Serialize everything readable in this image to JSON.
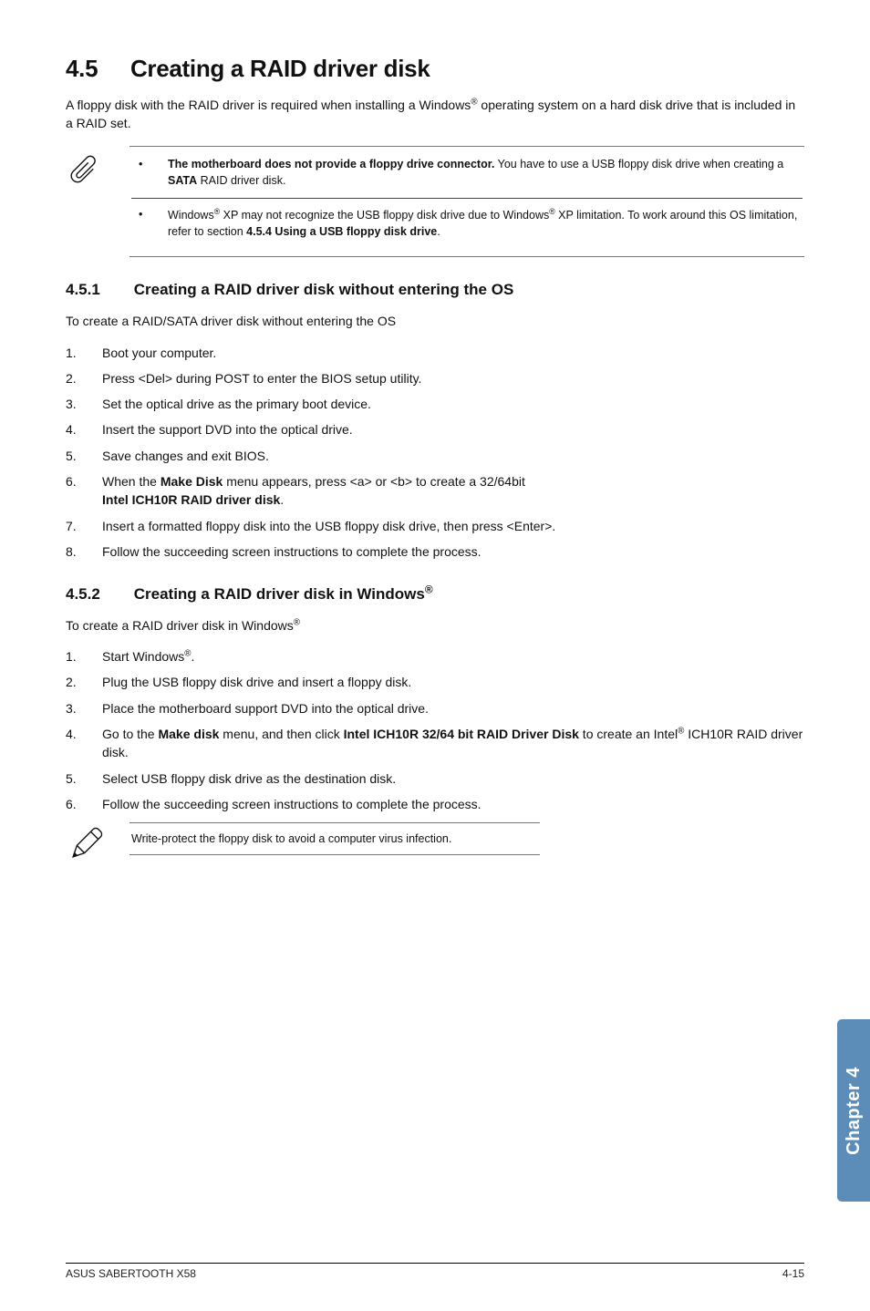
{
  "section": {
    "number": "4.5",
    "title": "Creating a RAID driver disk"
  },
  "intro": "A floppy disk with the RAID driver is required when installing a Windows® operating system on a hard disk drive that is included in a RAID set.",
  "note_bullets": [
    {
      "bold_lead": "The motherboard does not provide a floppy drive connector.",
      "rest": " You have to use a USB floppy disk drive when creating a ",
      "bold_mid": "SATA",
      "rest2": " RAID driver disk."
    },
    {
      "pre": "Windows® XP may not recognize the USB floppy disk drive due to Windows® XP limitation. To work around this OS limitation, refer to section ",
      "bold_tail": "4.5.4 Using a USB floppy disk drive",
      "post": "."
    }
  ],
  "sub1": {
    "number": "4.5.1",
    "title": "Creating a RAID driver disk without entering the OS",
    "lead": "To create a RAID/SATA driver disk without entering the OS",
    "steps": [
      "Boot your computer.",
      "Press <Del> during POST to enter the BIOS setup utility.",
      "Set the optical drive as the primary boot device.",
      "Insert the support DVD into the optical drive.",
      "Save changes and exit BIOS.",
      {
        "pre": "When the ",
        "b1": "Make Disk",
        "mid": " menu appears, press <a> or <b> to create a 32/64bit ",
        "b2": "Intel ICH10R RAID driver disk",
        "post": "."
      },
      "Insert a formatted floppy disk into the USB floppy disk drive, then press <Enter>.",
      "Follow the succeeding screen instructions to complete the process."
    ]
  },
  "sub2": {
    "number": "4.5.2",
    "title": "Creating a RAID driver disk in Windows®",
    "lead": "To create a RAID driver disk in Windows®",
    "steps": [
      "Start Windows®.",
      "Plug the USB floppy disk drive and insert a floppy disk.",
      "Place the motherboard support DVD into the optical drive.",
      {
        "pre": "Go to the ",
        "b1": "Make disk",
        "mid": " menu, and then click ",
        "b2": "Intel ICH10R 32/64 bit RAID Driver Disk",
        "post": " to create an Intel® ICH10R RAID driver disk."
      },
      "Select USB floppy disk drive as the destination disk.",
      "Follow the succeeding screen instructions to complete the process."
    ]
  },
  "tip": "Write-protect the floppy disk to avoid a computer virus infection.",
  "side_tab": "Chapter 4",
  "footer_left": "ASUS SABERTOOTH X58",
  "footer_right": "4-15"
}
